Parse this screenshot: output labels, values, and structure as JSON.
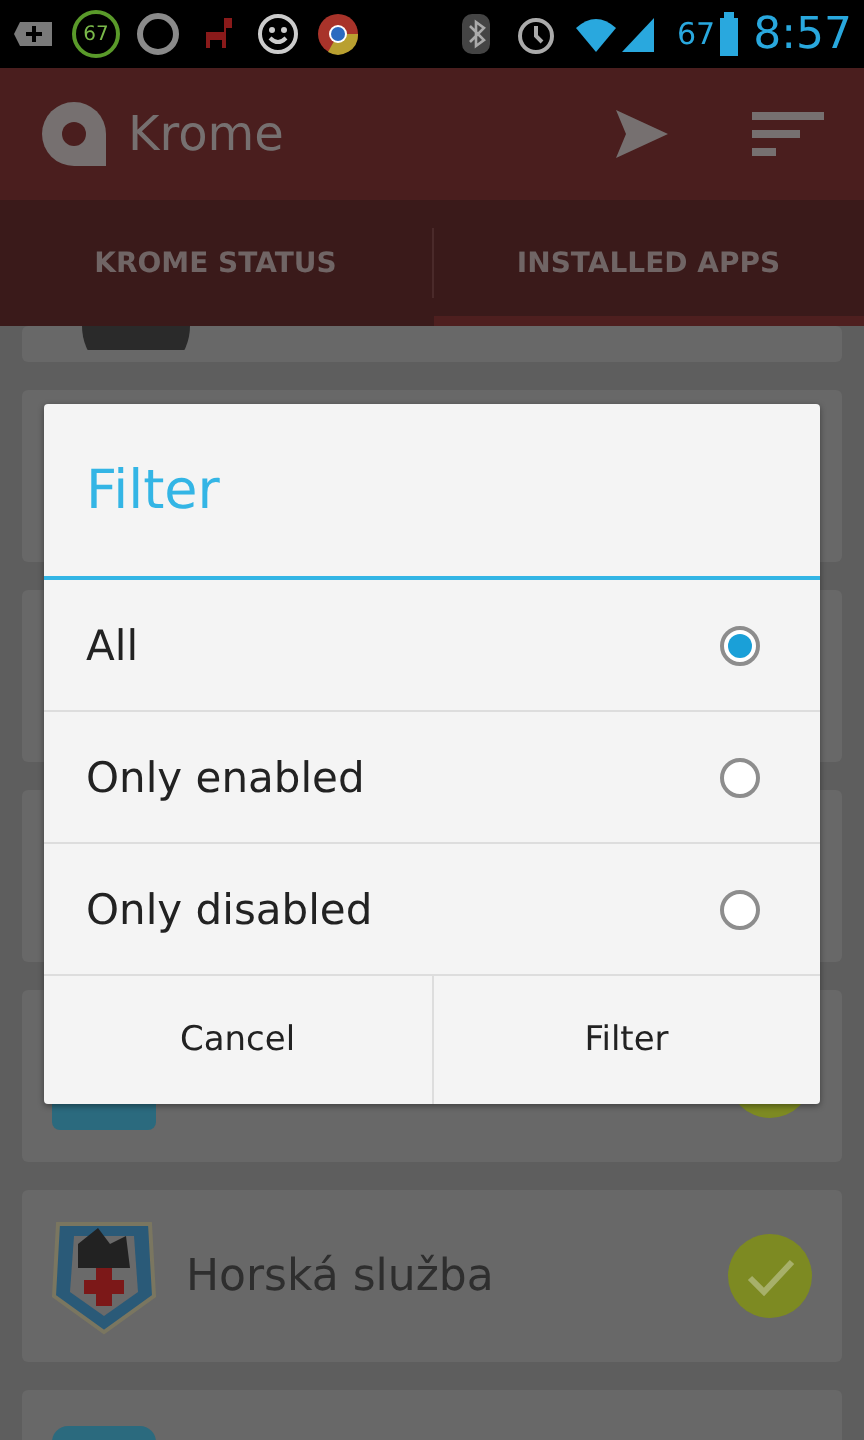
{
  "status_bar": {
    "battery_badge": "67",
    "battery_percent": "67",
    "time": "8:57"
  },
  "app_bar": {
    "title": "Krome"
  },
  "tabs": [
    {
      "label": "KROME STATUS",
      "selected": false
    },
    {
      "label": "INSTALLED APPS",
      "selected": true
    }
  ],
  "apps": [
    {
      "enabled": true
    },
    {
      "name": "Horská služba",
      "enabled": true
    }
  ],
  "dialog": {
    "title": "Filter",
    "options": [
      {
        "label": "All",
        "selected": true
      },
      {
        "label": "Only enabled",
        "selected": false
      },
      {
        "label": "Only disabled",
        "selected": false
      }
    ],
    "buttons": [
      "Cancel",
      "Filter"
    ]
  }
}
